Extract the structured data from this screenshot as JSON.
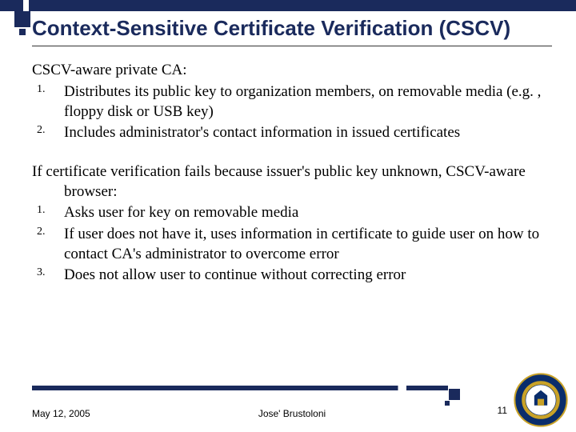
{
  "title": "Context-Sensitive Certificate Verification (CSCV)",
  "section1": {
    "intro": "CSCV-aware private CA:",
    "items": [
      "Distributes its public key to organization members, on removable media (e.g. , floppy disk or USB key)",
      "Includes administrator's contact information in issued certificates"
    ]
  },
  "section2": {
    "intro": "If certificate verification fails because issuer's public key unknown, CSCV-aware browser:",
    "items": [
      "Asks user for key on removable media",
      "If user does not have it, uses information in certificate to guide user on how to contact CA's administrator to overcome error",
      "Does not allow user to continue without correcting error"
    ]
  },
  "footer": {
    "date": "May 12, 2005",
    "author": "Jose' Brustoloni",
    "page": "11"
  }
}
